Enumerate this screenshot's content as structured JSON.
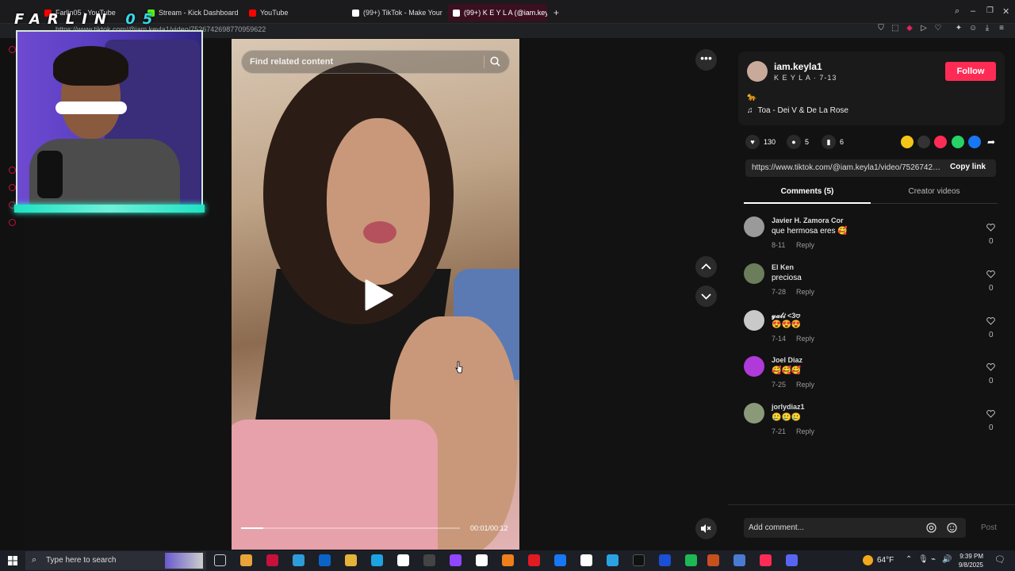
{
  "browser": {
    "tabs": [
      {
        "label": "Farlin05 - YouTube",
        "color": "#ff0000"
      },
      {
        "label": "Stream - Kick Dashboard",
        "color": "#53fc18"
      },
      {
        "label": "YouTube",
        "color": "#ff0000"
      },
      {
        "label": "(99+) TikTok - Make Your",
        "color": "#ffffff"
      },
      {
        "label": "(99+) K E Y L A (@iam.key",
        "color": "#ffffff"
      }
    ],
    "url": "https://www.tiktok.com/@iam.keyla1/video/7526742698770959622"
  },
  "overlay": {
    "logo_part1": "FARLIN",
    "logo_part2": "05"
  },
  "player": {
    "search_placeholder": "Find related content",
    "time": "00:01/00:12",
    "progress": 0.1
  },
  "creator": {
    "username": "iam.keyla1",
    "nickname": "K E Y L A · 7-13",
    "follow_label": "Follow",
    "description_emoji": "🐆",
    "music": "Toa - Dei V & De La Rose"
  },
  "stats": {
    "likes": "130",
    "comments": "5",
    "saves": "6"
  },
  "share": {
    "link": "https://www.tiktok.com/@iam.keyla1/video/7526742698770959622?is_from_webapp=1",
    "copy_label": "Copy link"
  },
  "tabs": {
    "comments": "Comments (5)",
    "creator_videos": "Creator videos"
  },
  "comments": [
    {
      "name": "Javier H. Zamora Cor",
      "text": "que hermosa eres 🥰",
      "date": "8-11",
      "likes": "0",
      "avatar": "#9a9a9a"
    },
    {
      "name": "El Ken",
      "text": "preciosa",
      "date": "7-28",
      "likes": "0",
      "avatar": "#6b7d5a"
    },
    {
      "name": "𝔂𝓪𝓵𝓲 <3𖹭",
      "text": "😍😍😍",
      "date": "7-14",
      "likes": "0",
      "avatar": "#c9c9c9"
    },
    {
      "name": "Joel Diaz",
      "text": "🥰🥰🥰",
      "date": "7-25",
      "likes": "0",
      "avatar": "#b03ad9"
    },
    {
      "name": "jorlydiaz1",
      "text": "🥲🥲🥲",
      "date": "7-21",
      "likes": "0",
      "avatar": "#8a9a78"
    }
  ],
  "reply_label": "Reply",
  "composer": {
    "placeholder": "Add comment...",
    "post_label": "Post"
  },
  "taskbar": {
    "search_text": "Type here to search",
    "weather": "64°F",
    "time": "9:39 PM",
    "date": "9/8/2025"
  }
}
